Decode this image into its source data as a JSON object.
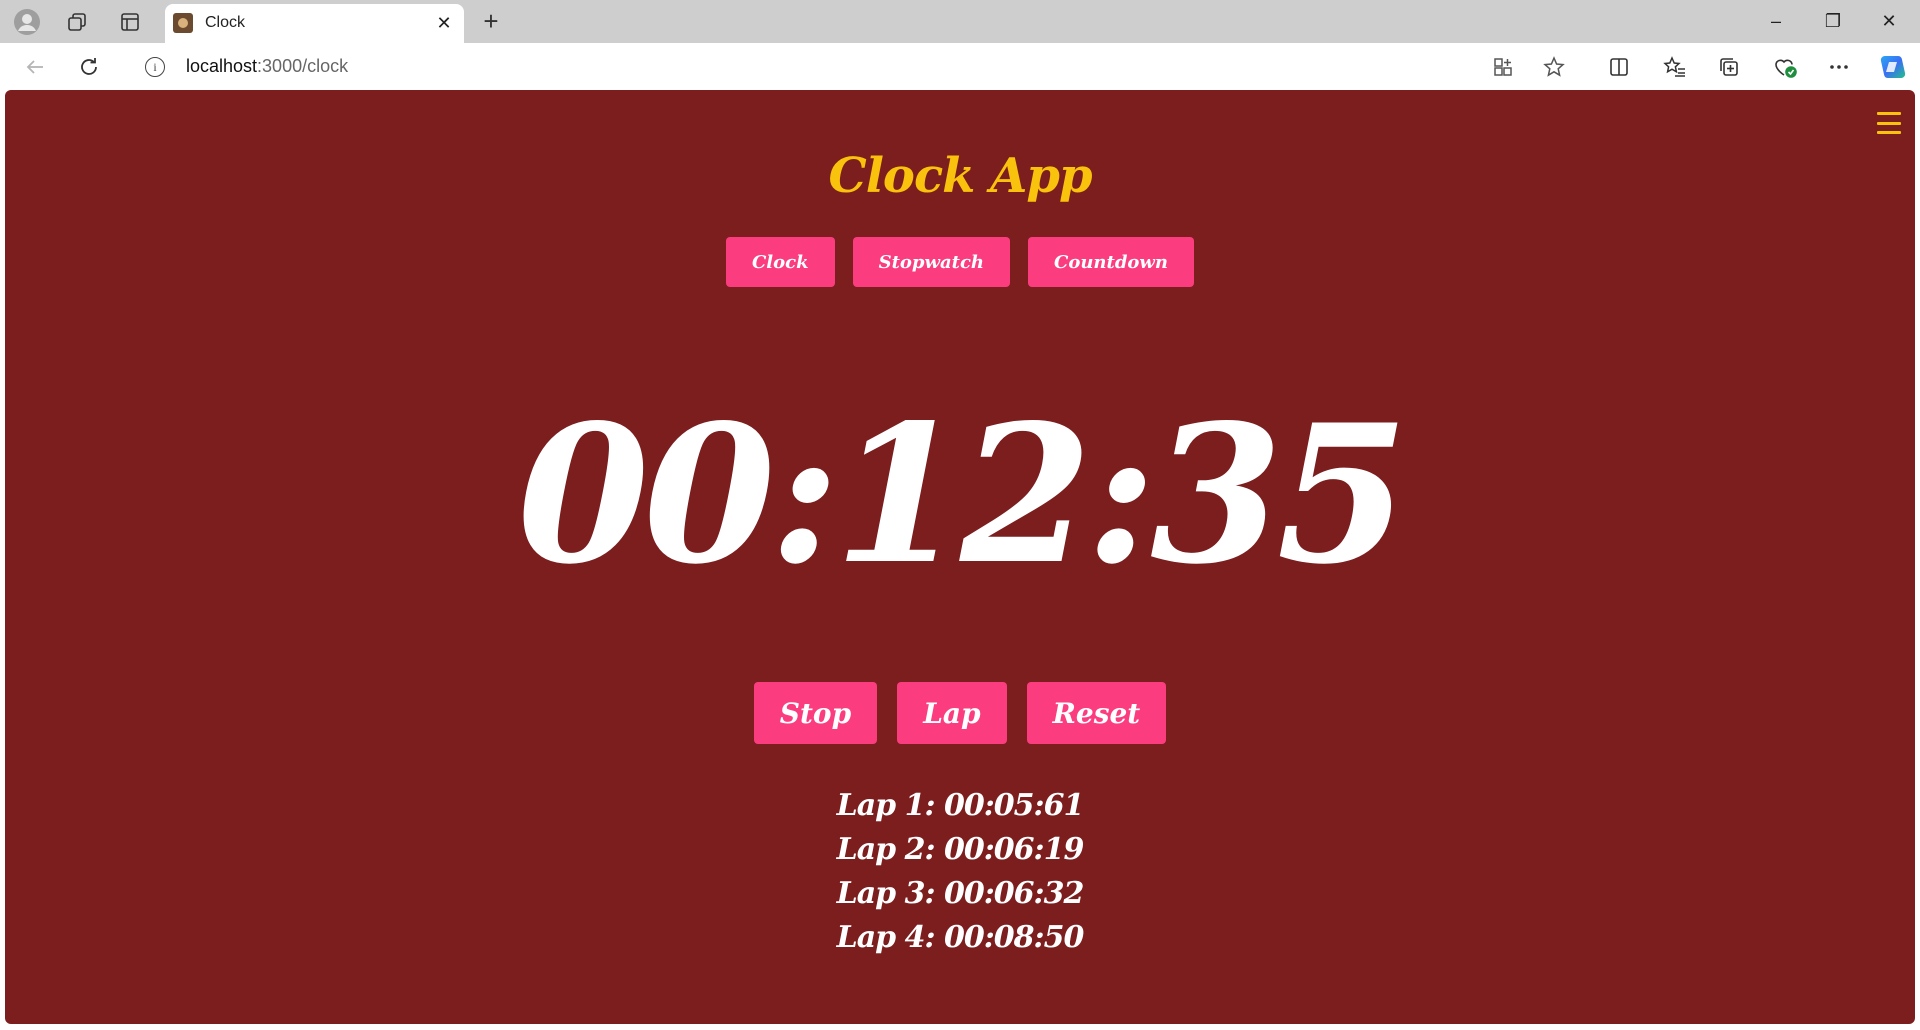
{
  "browser": {
    "tab_title": "Clock",
    "tab_close": "✕",
    "new_tab": "+",
    "url_host": "localhost",
    "url_path": ":3000/clock",
    "window_controls": [
      "–",
      "❐",
      "✕"
    ]
  },
  "app": {
    "title": "Clock App",
    "modes": [
      {
        "label": "Clock"
      },
      {
        "label": "Stopwatch"
      },
      {
        "label": "Countdown"
      }
    ],
    "time": "00:12:35",
    "controls": {
      "stop": "Stop",
      "lap": "Lap",
      "reset": "Reset"
    },
    "laps": [
      "Lap 1: 00:05:61",
      "Lap 2: 00:06:19",
      "Lap 3: 00:06:32",
      "Lap 4: 00:08:50"
    ]
  },
  "colors": {
    "background": "#7c1d1e",
    "title": "#f9c20c",
    "button": "#fb3d7f",
    "text": "#ffffff"
  }
}
